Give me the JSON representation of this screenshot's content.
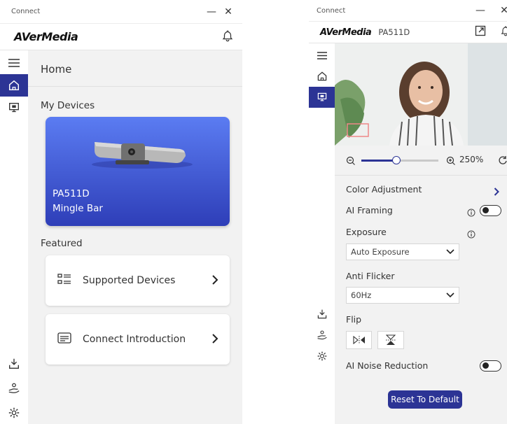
{
  "left_window": {
    "title": "Connect",
    "brand": "AVerMedia",
    "page_title": "Home",
    "my_devices_label": "My Devices",
    "device": {
      "model": "PA511D",
      "name": "Mingle Bar"
    },
    "featured_label": "Featured",
    "featured_items": [
      {
        "label": "Supported Devices",
        "icon": "device-list-icon"
      },
      {
        "label": "Connect Introduction",
        "icon": "intro-card-icon"
      }
    ]
  },
  "right_window": {
    "title": "Connect",
    "brand": "AVerMedia",
    "device_model": "PA511D",
    "zoom": {
      "value": 250,
      "label": "250%",
      "slider_fraction": 0.45
    },
    "settings": {
      "color_adjustment": "Color Adjustment",
      "ai_framing": "AI Framing",
      "ai_framing_on": false,
      "exposure": "Exposure",
      "exposure_value": "Auto Exposure",
      "anti_flicker": "Anti Flicker",
      "anti_flicker_value": "60Hz",
      "flip": "Flip",
      "ai_noise_reduction": "AI Noise Reduction",
      "ai_noise_reduction_on": false,
      "reset_button": "Reset To Default"
    }
  },
  "colors": {
    "accent": "#2c3495",
    "device_card_top": "#5b7cf2",
    "device_card_bottom": "#2e3eb8",
    "content_bg": "#f2f2f2"
  }
}
